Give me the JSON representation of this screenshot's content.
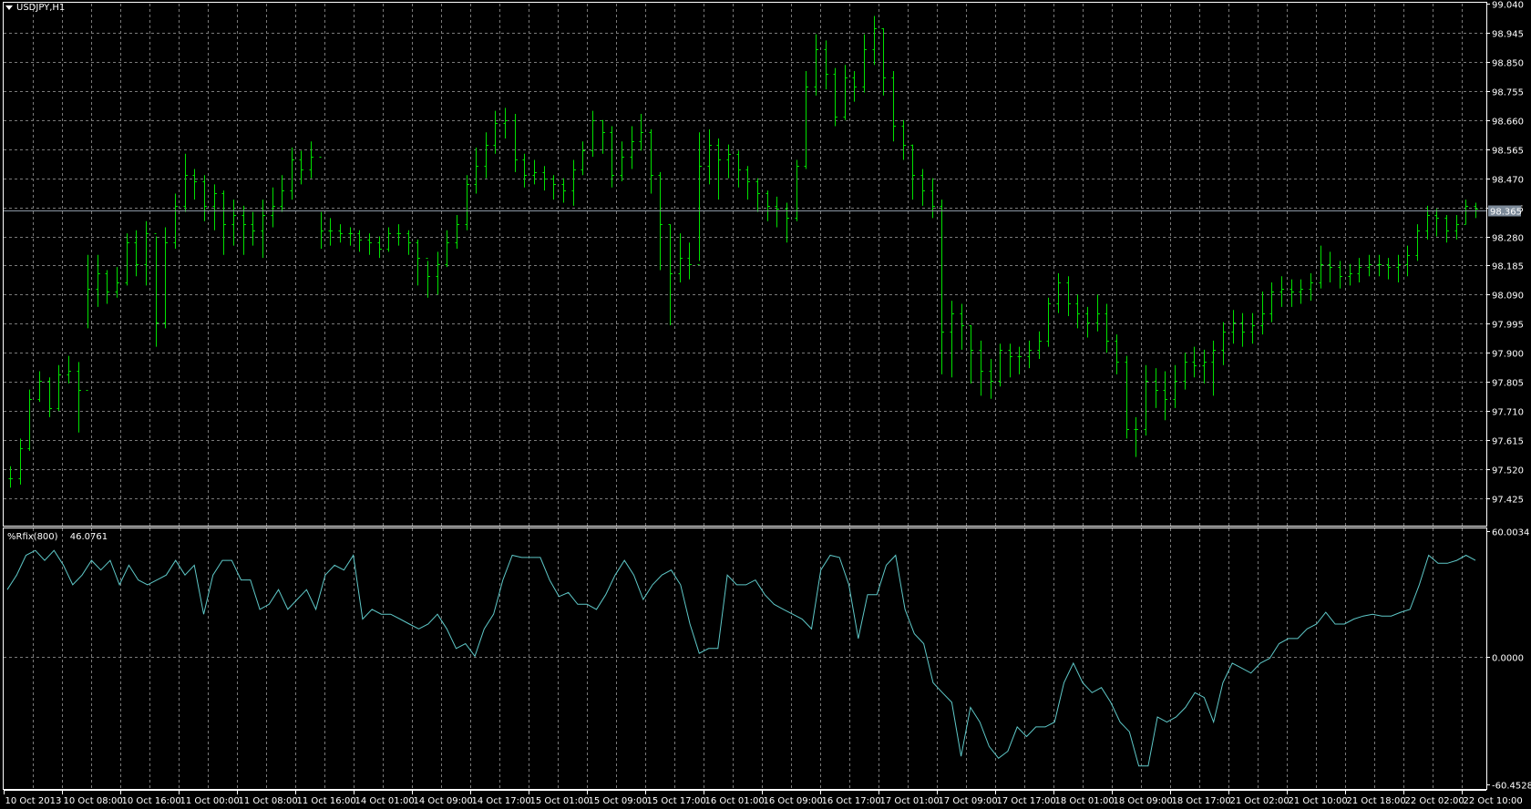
{
  "chart_title": "USDJPY,H1",
  "current_price": "98.365",
  "indicator": {
    "name": "%Rfix(800)",
    "value": "46.0761"
  },
  "colors": {
    "background": "#000000",
    "bars": "#00e000",
    "indicator_line": "#5ec8c8",
    "grid": "#7a7a7a",
    "price_line": "#8a96a3",
    "price_label_bg": "#7c8a99"
  },
  "chart_data": [
    {
      "type": "ohlc",
      "symbol": "USDJPY",
      "timeframe": "H1",
      "ylim": [
        97.425,
        99.04
      ],
      "y_ticks": [
        "99.040",
        "98.945",
        "98.850",
        "98.755",
        "98.660",
        "98.565",
        "98.470",
        "98.375",
        "98.280",
        "98.185",
        "98.090",
        "97.995",
        "97.900",
        "97.805",
        "97.710",
        "97.615",
        "97.520",
        "97.425"
      ],
      "x_ticks": [
        "10 Oct 2013",
        "10 Oct 08:00",
        "10 Oct 16:00",
        "11 Oct 00:00",
        "11 Oct 08:00",
        "11 Oct 16:00",
        "14 Oct 01:00",
        "14 Oct 09:00",
        "14 Oct 17:00",
        "15 Oct 01:00",
        "15 Oct 09:00",
        "15 Oct 17:00",
        "16 Oct 01:00",
        "16 Oct 09:00",
        "16 Oct 17:00",
        "17 Oct 01:00",
        "17 Oct 09:00",
        "17 Oct 17:00",
        "18 Oct 01:00",
        "18 Oct 09:00",
        "18 Oct 17:00",
        "21 Oct 02:00",
        "21 Oct 10:00",
        "21 Oct 18:00",
        "22 Oct 02:00",
        "22 Oct 10:00"
      ],
      "bars_hlc": [
        [
          97.53,
          97.46,
          97.49
        ],
        [
          97.62,
          97.47,
          97.59
        ],
        [
          97.78,
          97.58,
          97.75
        ],
        [
          97.84,
          97.74,
          97.81
        ],
        [
          97.82,
          97.69,
          97.72
        ],
        [
          97.86,
          97.71,
          97.83
        ],
        [
          97.89,
          97.8,
          97.84
        ],
        [
          97.87,
          97.64,
          97.78
        ],
        [
          98.22,
          97.98,
          98.11
        ],
        [
          98.22,
          98.05,
          98.16
        ],
        [
          98.17,
          98.06,
          98.1
        ],
        [
          98.18,
          98.08,
          98.13
        ],
        [
          98.29,
          98.12,
          98.26
        ],
        [
          98.3,
          98.15,
          98.19
        ],
        [
          98.33,
          98.12,
          98.29
        ],
        [
          98.28,
          97.92,
          98.0
        ],
        [
          98.31,
          97.98,
          98.26
        ],
        [
          98.42,
          98.24,
          98.38
        ],
        [
          98.55,
          98.36,
          98.48
        ],
        [
          98.5,
          98.4,
          98.46
        ],
        [
          98.48,
          98.33,
          98.38
        ],
        [
          98.45,
          98.3,
          98.42
        ],
        [
          98.43,
          98.22,
          98.32
        ],
        [
          98.4,
          98.25,
          98.35
        ],
        [
          98.38,
          98.22,
          98.32
        ],
        [
          98.36,
          98.25,
          98.3
        ],
        [
          98.4,
          98.21,
          98.35
        ],
        [
          98.44,
          98.31,
          98.38
        ],
        [
          98.48,
          98.36,
          98.43
        ],
        [
          98.57,
          98.4,
          98.53
        ],
        [
          98.56,
          98.45,
          98.5
        ],
        [
          98.59,
          98.47,
          98.54
        ],
        [
          98.36,
          98.24,
          98.3
        ],
        [
          98.34,
          98.25,
          98.3
        ],
        [
          98.32,
          98.26,
          98.29
        ],
        [
          98.31,
          98.25,
          98.29
        ],
        [
          98.3,
          98.23,
          98.27
        ],
        [
          98.29,
          98.22,
          98.26
        ],
        [
          98.28,
          98.21,
          98.24
        ],
        [
          98.31,
          98.23,
          98.29
        ],
        [
          98.32,
          98.25,
          98.29
        ],
        [
          98.3,
          98.22,
          98.26
        ],
        [
          98.27,
          98.12,
          98.21
        ],
        [
          98.2,
          98.08,
          98.15
        ],
        [
          98.23,
          98.09,
          98.19
        ],
        [
          98.3,
          98.18,
          98.26
        ],
        [
          98.35,
          98.24,
          98.32
        ],
        [
          98.48,
          98.3,
          98.45
        ],
        [
          98.57,
          98.42,
          98.51
        ],
        [
          98.62,
          98.47,
          98.58
        ],
        [
          98.69,
          98.55,
          98.65
        ],
        [
          98.7,
          98.6,
          98.66
        ],
        [
          98.68,
          98.49,
          98.53
        ],
        [
          98.55,
          98.44,
          98.48
        ],
        [
          98.53,
          98.45,
          98.49
        ],
        [
          98.51,
          98.43,
          98.47
        ],
        [
          98.48,
          98.4,
          98.45
        ],
        [
          98.47,
          98.39,
          98.43
        ],
        [
          98.53,
          98.38,
          98.5
        ],
        [
          98.59,
          98.48,
          98.56
        ],
        [
          98.69,
          98.54,
          98.66
        ],
        [
          98.66,
          98.55,
          98.62
        ],
        [
          98.64,
          98.44,
          98.48
        ],
        [
          98.59,
          98.46,
          98.54
        ],
        [
          98.64,
          98.5,
          98.59
        ],
        [
          98.68,
          98.56,
          98.62
        ],
        [
          98.63,
          98.42,
          98.48
        ],
        [
          98.49,
          98.17,
          98.32
        ],
        [
          98.32,
          97.99,
          98.16
        ],
        [
          98.29,
          98.13,
          98.21
        ],
        [
          98.26,
          98.14,
          98.19
        ],
        [
          98.62,
          98.2,
          98.51
        ],
        [
          98.63,
          98.45,
          98.58
        ],
        [
          98.6,
          98.4,
          98.53
        ],
        [
          98.58,
          98.47,
          98.55
        ],
        [
          98.56,
          98.44,
          98.5
        ],
        [
          98.51,
          98.4,
          98.46
        ],
        [
          98.47,
          98.36,
          98.42
        ],
        [
          98.43,
          98.33,
          98.38
        ],
        [
          98.41,
          98.31,
          98.37
        ],
        [
          98.39,
          98.26,
          98.34
        ],
        [
          98.53,
          98.33,
          98.51
        ],
        [
          98.82,
          98.5,
          98.77
        ],
        [
          98.94,
          98.74,
          98.89
        ],
        [
          98.92,
          98.76,
          98.81
        ],
        [
          98.83,
          98.64,
          98.67
        ],
        [
          98.84,
          98.66,
          98.8
        ],
        [
          98.82,
          98.72,
          98.77
        ],
        [
          98.94,
          98.75,
          98.89
        ],
        [
          99.0,
          98.84,
          98.96
        ],
        [
          98.96,
          98.74,
          98.8
        ],
        [
          98.82,
          98.59,
          98.64
        ],
        [
          98.66,
          98.53,
          98.58
        ],
        [
          98.58,
          98.4,
          98.48
        ],
        [
          98.5,
          98.38,
          98.43
        ],
        [
          98.47,
          98.34,
          98.38
        ],
        [
          98.4,
          97.83,
          97.97
        ],
        [
          98.07,
          97.82,
          98.03
        ],
        [
          98.06,
          97.91,
          97.99
        ],
        [
          97.99,
          97.8,
          97.91
        ],
        [
          97.94,
          97.76,
          97.84
        ],
        [
          97.88,
          97.75,
          97.81
        ],
        [
          97.93,
          97.79,
          97.91
        ],
        [
          97.93,
          97.82,
          97.89
        ],
        [
          97.92,
          97.83,
          97.89
        ],
        [
          97.94,
          97.85,
          97.91
        ],
        [
          97.97,
          97.88,
          97.94
        ],
        [
          98.08,
          97.92,
          98.06
        ],
        [
          98.16,
          98.03,
          98.13
        ],
        [
          98.15,
          98.02,
          98.06
        ],
        [
          98.09,
          97.98,
          98.03
        ],
        [
          98.05,
          97.95,
          98.0
        ],
        [
          98.09,
          97.97,
          98.03
        ],
        [
          98.06,
          97.9,
          97.94
        ],
        [
          97.96,
          97.83,
          97.87
        ],
        [
          97.89,
          97.62,
          97.65
        ],
        [
          97.69,
          97.56,
          97.65
        ],
        [
          97.86,
          97.63,
          97.81
        ],
        [
          97.85,
          97.72,
          97.78
        ],
        [
          97.84,
          97.68,
          97.75
        ],
        [
          97.86,
          97.72,
          97.81
        ],
        [
          97.9,
          97.78,
          97.87
        ],
        [
          97.92,
          97.82,
          97.86
        ],
        [
          97.91,
          97.8,
          97.87
        ],
        [
          97.94,
          97.76,
          97.91
        ],
        [
          98.0,
          97.86,
          97.97
        ],
        [
          98.04,
          97.93,
          98.0
        ],
        [
          98.03,
          97.92,
          97.97
        ],
        [
          98.03,
          97.93,
          97.99
        ],
        [
          98.1,
          97.96,
          98.03
        ],
        [
          98.13,
          98.0,
          98.1
        ],
        [
          98.15,
          98.05,
          98.11
        ],
        [
          98.14,
          98.05,
          98.1
        ],
        [
          98.14,
          98.06,
          98.11
        ],
        [
          98.16,
          98.07,
          98.13
        ],
        [
          98.25,
          98.11,
          98.19
        ],
        [
          98.23,
          98.13,
          98.18
        ],
        [
          98.2,
          98.11,
          98.15
        ],
        [
          98.19,
          98.12,
          98.16
        ],
        [
          98.21,
          98.13,
          98.18
        ],
        [
          98.22,
          98.15,
          98.19
        ],
        [
          98.22,
          98.15,
          98.19
        ],
        [
          98.21,
          98.14,
          98.18
        ],
        [
          98.22,
          98.13,
          98.19
        ],
        [
          98.25,
          98.15,
          98.22
        ],
        [
          98.32,
          98.2,
          98.3
        ],
        [
          98.38,
          98.27,
          98.35
        ],
        [
          98.37,
          98.28,
          98.34
        ],
        [
          98.35,
          98.26,
          98.3
        ],
        [
          98.35,
          98.27,
          98.32
        ],
        [
          98.4,
          98.32,
          98.38
        ],
        [
          98.39,
          98.34,
          98.37
        ]
      ]
    },
    {
      "type": "line",
      "name": "%Rfix(800)",
      "ylim": [
        -60.4528,
        60.0034
      ],
      "y_ticks": [
        "60.0034",
        "0.0000",
        "-60.4528"
      ],
      "values": [
        32.2,
        39.1,
        48.5,
        50.8,
        46.1,
        50.8,
        43.8,
        34.5,
        39.1,
        46.1,
        41.5,
        46.1,
        34.5,
        43.8,
        36.8,
        34.5,
        36.8,
        39.1,
        46.1,
        39.1,
        43.8,
        20.5,
        39.1,
        46.1,
        46.1,
        36.8,
        36.8,
        22.8,
        25.2,
        32.2,
        22.8,
        27.5,
        32.2,
        22.8,
        39.1,
        43.8,
        41.5,
        48.5,
        18.2,
        22.8,
        20.5,
        20.5,
        18.2,
        15.8,
        13.5,
        15.8,
        20.5,
        13.5,
        4.2,
        6.5,
        0.5,
        13.5,
        20.5,
        36.8,
        48.5,
        47.5,
        47.5,
        47.5,
        36.8,
        28.9,
        30.8,
        25.2,
        25.2,
        22.8,
        29.8,
        39.1,
        46.1,
        39.1,
        27.5,
        34.5,
        39.1,
        41.5,
        34.5,
        15.8,
        1.9,
        4.2,
        4.2,
        39.1,
        34.5,
        34.5,
        36.8,
        29.8,
        25.2,
        22.8,
        20.5,
        18.2,
        13.5,
        41.5,
        48.5,
        47.5,
        34.5,
        8.9,
        29.8,
        29.8,
        43.8,
        48.5,
        22.8,
        11.2,
        6.5,
        -12.1,
        -16.8,
        -21.4,
        -47.1,
        -23.8,
        -30.8,
        -42.4,
        -48.0,
        -44.7,
        -33.1,
        -37.7,
        -33.1,
        -33.1,
        -30.8,
        -12.1,
        -2.8,
        -12.1,
        -16.8,
        -14.4,
        -21.4,
        -30.8,
        -35.4,
        -51.7,
        -51.7,
        -28.4,
        -30.8,
        -28.4,
        -23.8,
        -16.8,
        -19.1,
        -30.8,
        -12.1,
        -2.8,
        -5.1,
        -7.5,
        -2.8,
        -0.5,
        6.5,
        8.9,
        8.9,
        13.5,
        15.8,
        21.4,
        15.8,
        15.8,
        18.2,
        19.6,
        20.5,
        19.6,
        19.6,
        21.4,
        22.8,
        34.5,
        48.5,
        44.7,
        44.7,
        46.1,
        48.5,
        46.1
      ]
    }
  ]
}
